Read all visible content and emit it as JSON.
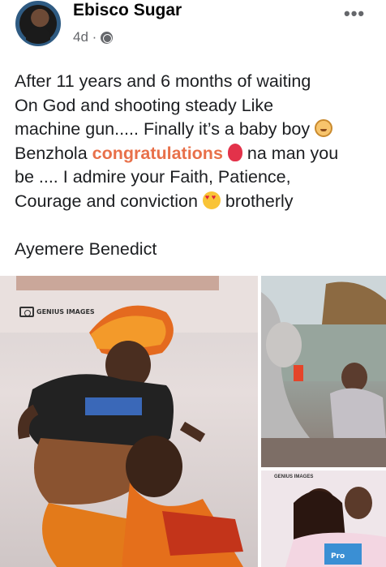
{
  "post": {
    "author": "Ebisco Sugar",
    "time": "4d ·",
    "more": "•••",
    "lines": [
      "After 11 years and 6 months of waiting",
      "On God  and shooting steady Like",
      "machine gun.....  Finally it’s a baby boy",
      "Benzhola",
      "congratulations",
      "na man you",
      "be .... I admire your Faith, Patience,",
      "Courage and conviction",
      "brotherly",
      "Ayemere Benedict"
    ]
  },
  "photos": {
    "watermark": "GENIUS IMAGES",
    "watermark_small": "GENIUS IMAGES"
  },
  "icons": {
    "globe": "globe-icon",
    "more": "more-options-icon",
    "emoji1": "baby-emoji",
    "emoji2": "balloon-emoji",
    "emoji3": "heart-eyes-emoji"
  }
}
